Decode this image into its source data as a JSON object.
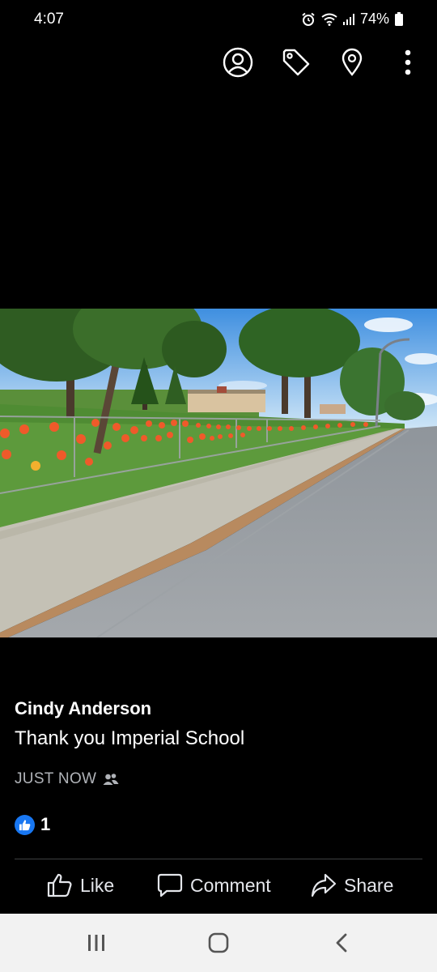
{
  "status_bar": {
    "time": "4:07",
    "battery": "74%",
    "icons": [
      "alarm-icon",
      "wifi-icon",
      "signal-icon",
      "battery-icon"
    ]
  },
  "top_actions": {
    "icons": [
      "tag-person-icon",
      "tag-icon",
      "location-icon",
      "more-vertical-icon"
    ]
  },
  "post": {
    "author": "Cindy Anderson",
    "caption": "Thank you Imperial School",
    "timestamp": "JUST NOW",
    "audience_icon": "friends-icon",
    "reaction_count": "1",
    "reaction_icon": "like-reaction-icon"
  },
  "actions": {
    "like": "Like",
    "comment": "Comment",
    "share": "Share"
  },
  "nav": {
    "icons": [
      "recent-apps-icon",
      "home-icon",
      "back-icon"
    ]
  },
  "colors": {
    "background": "#000000",
    "accent": "#1877f2",
    "secondary_text": "#b0b3b8",
    "nav_bg": "#f2f2f2"
  }
}
